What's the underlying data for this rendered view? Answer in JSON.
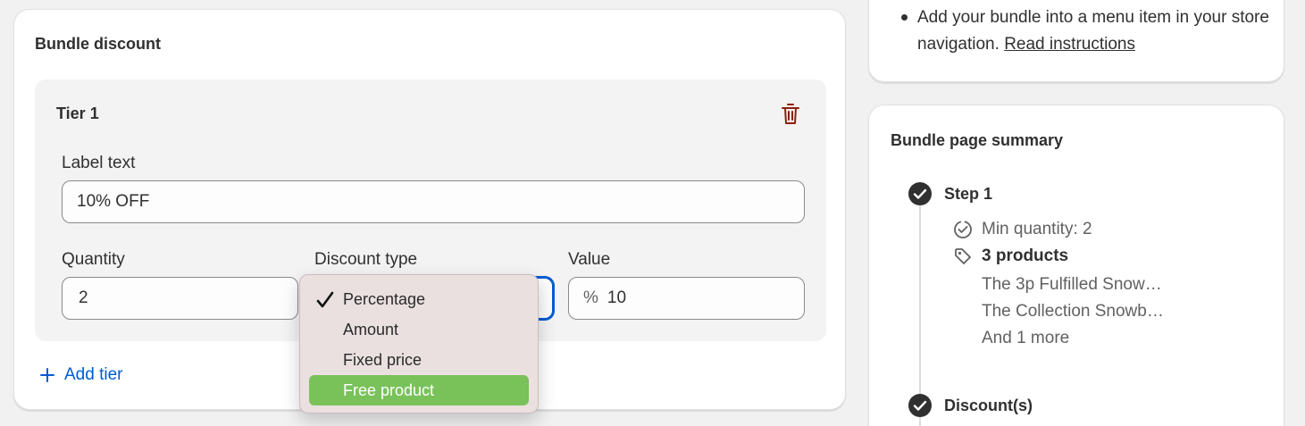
{
  "bundle_discount": {
    "title": "Bundle discount",
    "tier": {
      "title": "Tier 1",
      "label_text_label": "Label text",
      "label_text_value": "10% OFF",
      "quantity_label": "Quantity",
      "quantity_value": "2",
      "discount_type_label": "Discount type",
      "value_label": "Value",
      "value_prefix": "%",
      "value_value": "10"
    },
    "add_tier_label": "Add tier"
  },
  "discount_type_menu": {
    "options": [
      "Percentage",
      "Amount",
      "Fixed price",
      "Free product"
    ],
    "selected": "Percentage",
    "highlighted": "Free product"
  },
  "instructions": {
    "bullet_text": "Add your bundle into a menu item in your store navigation. ",
    "link_text": "Read instructions"
  },
  "summary": {
    "title": "Bundle page summary",
    "step1": {
      "label": "Step 1",
      "min_quantity": "Min quantity: 2",
      "products_count": "3 products",
      "product_1": "The 3p Fulfilled Snow…",
      "product_2": "The Collection Snowb…",
      "more": "And 1 more"
    },
    "discounts_label": "Discount(s)"
  },
  "colors": {
    "accent": "#005bd3",
    "danger": "#8e1f0b",
    "highlight": "#79c25a"
  },
  "icons": [
    "trash-icon",
    "plus-icon",
    "checkmark-icon",
    "circle-check-icon",
    "badge-check-icon",
    "tag-icon"
  ]
}
